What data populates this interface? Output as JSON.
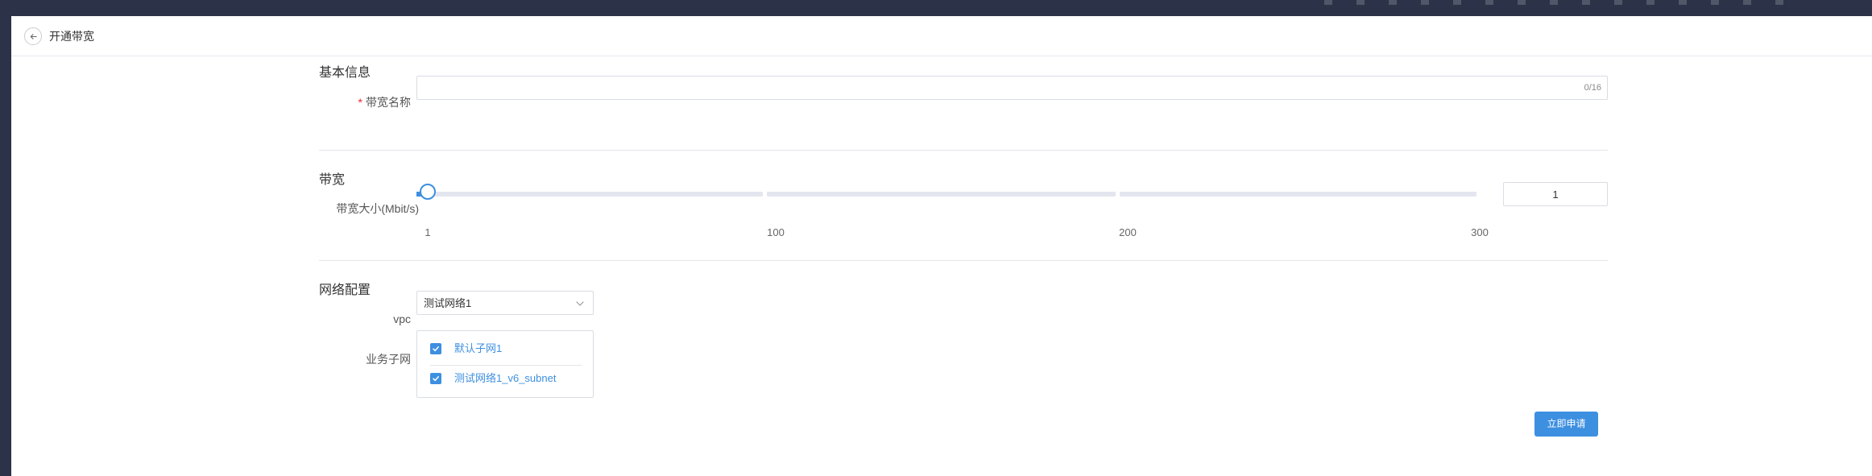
{
  "header": {
    "title": "开通带宽"
  },
  "sections": {
    "basic": "基本信息",
    "bandwidth": "带宽",
    "network": "网络配置"
  },
  "basic": {
    "name_label": "带宽名称",
    "name_value": "",
    "name_counter": "0/16"
  },
  "bandwidth": {
    "size_label": "带宽大小(Mbit/s)",
    "value": 1,
    "value_text": "1",
    "min": 1,
    "max": 300,
    "ticks": [
      "1",
      "100",
      "200",
      "300"
    ]
  },
  "network": {
    "vpc_label": "vpc",
    "vpc_value": "测试网络1",
    "subnet_label": "业务子网",
    "subnets": [
      {
        "label": "默认子网1",
        "checked": true
      },
      {
        "label": "测试网络1_v6_subnet",
        "checked": true
      }
    ]
  },
  "actions": {
    "submit": "立即申请"
  },
  "colors": {
    "accent": "#3d8fe0",
    "required": "#f5222d",
    "topbar": "#2c3248"
  }
}
